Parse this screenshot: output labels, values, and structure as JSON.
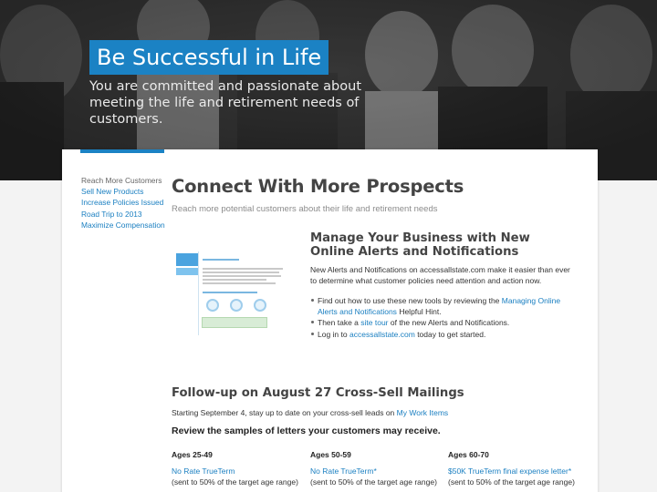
{
  "hero": {
    "title": "Be Successful in Life",
    "subtitle": "You are committed and passionate about meeting the life and retirement needs of customers."
  },
  "sidebar": {
    "active": "Reach More Customers",
    "items": [
      {
        "label": "Sell New Products"
      },
      {
        "label": "Increase Policies Issued"
      },
      {
        "label": "Road Trip to 2013"
      },
      {
        "label": "Maximize Compensation"
      }
    ]
  },
  "main": {
    "title": "Connect With More Prospects",
    "intro": "Reach more potential customers about their life and retirement needs",
    "alerts": {
      "title": "Manage Your Business with New Online Alerts and Notifications",
      "body": "New Alerts and Notifications on accessallstate.com make it easier than ever to determine what customer policies need attention and action now.",
      "bullet1_pre": "Find out how to use these new tools by reviewing the",
      "bullet1_link": "Managing Online Alerts and Notifications",
      "bullet1_post": "Helpful Hint.",
      "bullet2_pre": "Then take a",
      "bullet2_link": "site tour",
      "bullet2_post": "of the new Alerts and Notifications.",
      "bullet3_pre": "Log in to",
      "bullet3_link": "accessallstate.com",
      "bullet3_post": "today to get started."
    },
    "followup": {
      "title": "Follow-up on August 27 Cross-Sell Mailings",
      "body_pre": "Starting September 4, stay up to date on your cross-sell leads on",
      "body_link": "My Work Items",
      "strong": "Review the samples of letters your customers may receive.",
      "columns": [
        {
          "age": "Ages 25-49",
          "link": "No Rate TrueTerm",
          "note": "(sent to 50% of the target age range)"
        },
        {
          "age": "Ages 50-59",
          "link": "No Rate TrueTerm*",
          "note": "(sent to 50% of the target age range)"
        },
        {
          "age": "Ages 60-70",
          "link": "$50K TrueTerm final expense letter*",
          "note": "(sent to 50% of the target age range)"
        }
      ]
    }
  },
  "colors": {
    "accent": "#1b82c4",
    "link": "#1a7fc1"
  }
}
